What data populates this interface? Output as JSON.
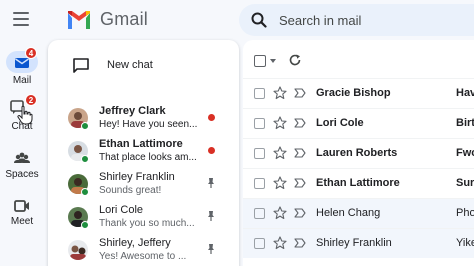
{
  "app": {
    "name": "Gmail"
  },
  "colors": {
    "accent": "#d3e3fd",
    "badge": "#d93025",
    "online": "#1e8e3e",
    "search_bg": "#eaf1fb"
  },
  "search": {
    "placeholder": "Search in mail"
  },
  "rail": {
    "items": [
      {
        "label": "Mail",
        "icon": "mail-icon",
        "badge": "4",
        "active": true
      },
      {
        "label": "Chat",
        "icon": "chat-icon",
        "badge": "2",
        "active": false
      },
      {
        "label": "Spaces",
        "icon": "spaces-icon"
      },
      {
        "label": "Meet",
        "icon": "meet-icon"
      }
    ]
  },
  "chat": {
    "new_chat_label": "New chat",
    "items": [
      {
        "name": "Jeffrey Clark",
        "snippet": "Hey! Have you seen...",
        "unread": true,
        "status": "unread-dot",
        "online": true
      },
      {
        "name": "Ethan Lattimore",
        "snippet": "That place looks am...",
        "unread": true,
        "status": "unread-dot",
        "online": true
      },
      {
        "name": "Shirley Franklin",
        "snippet": "Sounds great!",
        "unread": false,
        "status": "pin-icon",
        "online": true
      },
      {
        "name": "Lori Cole",
        "snippet": "Thank you so much...",
        "unread": false,
        "status": "pin-icon",
        "online": true
      },
      {
        "name": "Shirley, Jeffery",
        "snippet": "Yes! Awesome to ...",
        "unread": false,
        "status": "pin-icon",
        "online": false
      }
    ]
  },
  "mail": {
    "rows": [
      {
        "sender": "Gracie Bishop",
        "subject": "Hav",
        "unread": true
      },
      {
        "sender": "Lori Cole",
        "subject": "Birt",
        "unread": true
      },
      {
        "sender": "Lauren Roberts",
        "subject": "Fwo",
        "unread": true
      },
      {
        "sender": "Ethan Lattimore",
        "subject": "Sur",
        "unread": true
      },
      {
        "sender": "Helen Chang",
        "subject": "Pho",
        "unread": false
      },
      {
        "sender": "Shirley Franklin",
        "subject": "Yike",
        "unread": false
      }
    ]
  }
}
